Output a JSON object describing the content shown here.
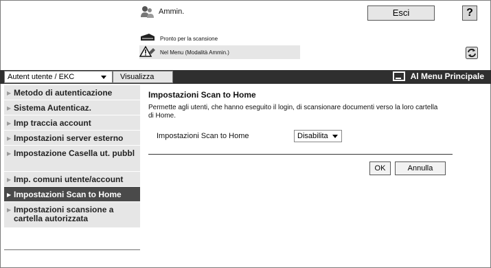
{
  "header": {
    "user_label": "Ammin.",
    "exit_label": "Esci",
    "help_label": "?",
    "status_ready": "Pronto per la scansione",
    "status_menu": "Nel Menu (Modalità Ammin.)"
  },
  "navbar": {
    "mode_select_value": "Autent utente / EKC",
    "view_tab_label": "Visualizza",
    "main_menu_label": "Al Menu Principale"
  },
  "sidebar": {
    "items": [
      {
        "label": "Metodo di autenticazione",
        "active": false
      },
      {
        "label": "Sistema Autenticaz.",
        "active": false
      },
      {
        "label": "Imp traccia account",
        "active": false
      },
      {
        "label": "Impostazioni server esterno",
        "active": false
      },
      {
        "label": "Impostazione Casella ut. pubbl",
        "active": false
      },
      {
        "label": "Imp. comuni utente/account",
        "active": false
      },
      {
        "label": "Impostazioni Scan to Home",
        "active": true
      },
      {
        "label": "Impostazioni scansione a cartella autorizzata",
        "active": false
      }
    ]
  },
  "main": {
    "title": "Impostazioni Scan to Home",
    "description": "Permette agli utenti, che hanno eseguito il login, di scansionare documenti verso la loro cartella di Home.",
    "setting_label": "Impostazioni Scan to Home",
    "setting_value": "Disabilita",
    "ok_label": "OK",
    "cancel_label": "Annulla"
  },
  "icons": {
    "user": "admin-user-icon",
    "scanner": "scanner-icon",
    "warning": "warning-icon",
    "refresh": "refresh-icon",
    "menu": "menu-screen-icon"
  },
  "colors": {
    "navbar_bg": "#2f2f2f",
    "active_item_bg": "#4a4a4a",
    "sidebar_item_bg": "#e6e6e6"
  }
}
